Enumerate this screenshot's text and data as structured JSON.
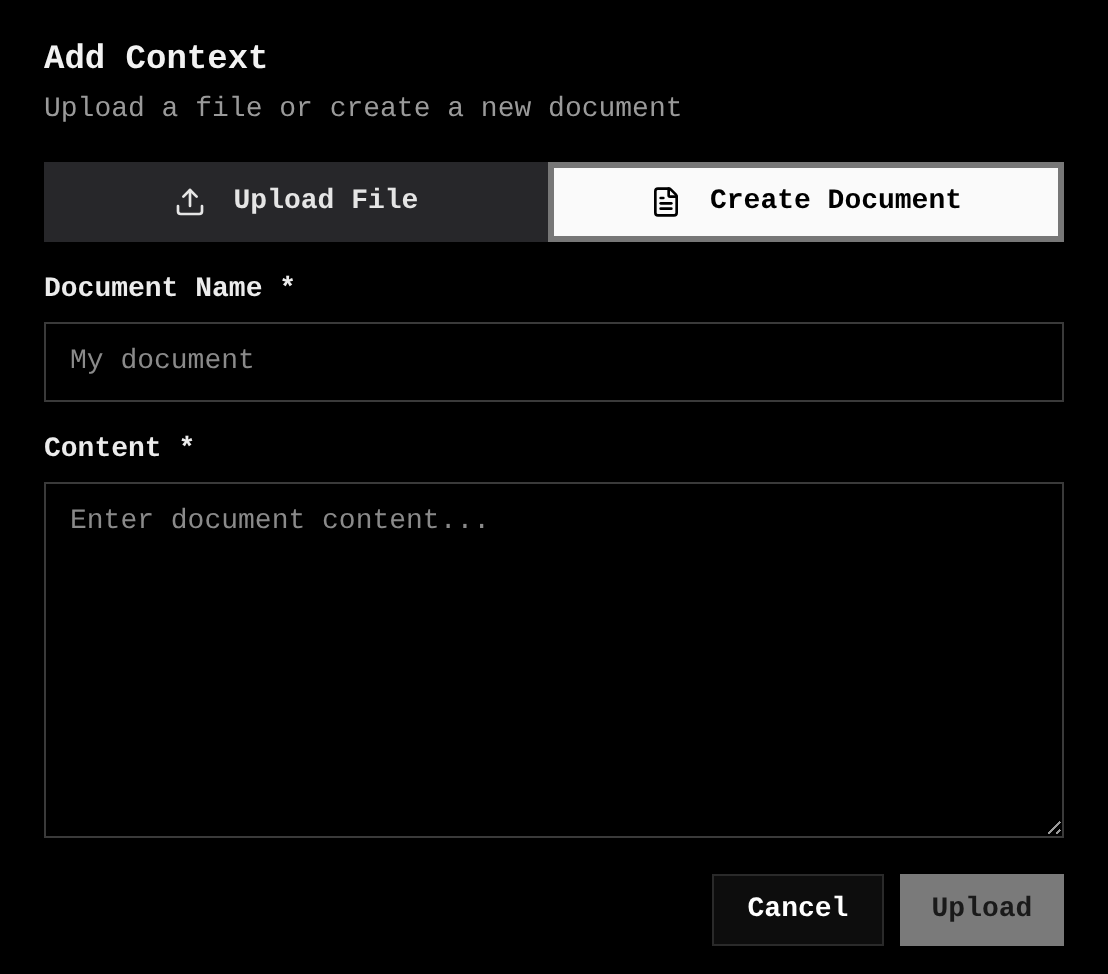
{
  "dialog": {
    "title": "Add Context",
    "subtitle": "Upload a file or create a new document"
  },
  "tabs": [
    {
      "label": "Upload File",
      "kind": "upload",
      "selected": false
    },
    {
      "label": "Create Document",
      "kind": "document",
      "selected": true
    }
  ],
  "fields": [
    {
      "label": "Document Name *",
      "kind": "input",
      "placeholder": "My document"
    },
    {
      "label": "Content *",
      "kind": "textarea",
      "placeholder": "Enter document content..."
    }
  ],
  "buttons": [
    {
      "label": "Cancel",
      "disabled": false
    },
    {
      "label": "Upload",
      "disabled": true
    }
  ]
}
